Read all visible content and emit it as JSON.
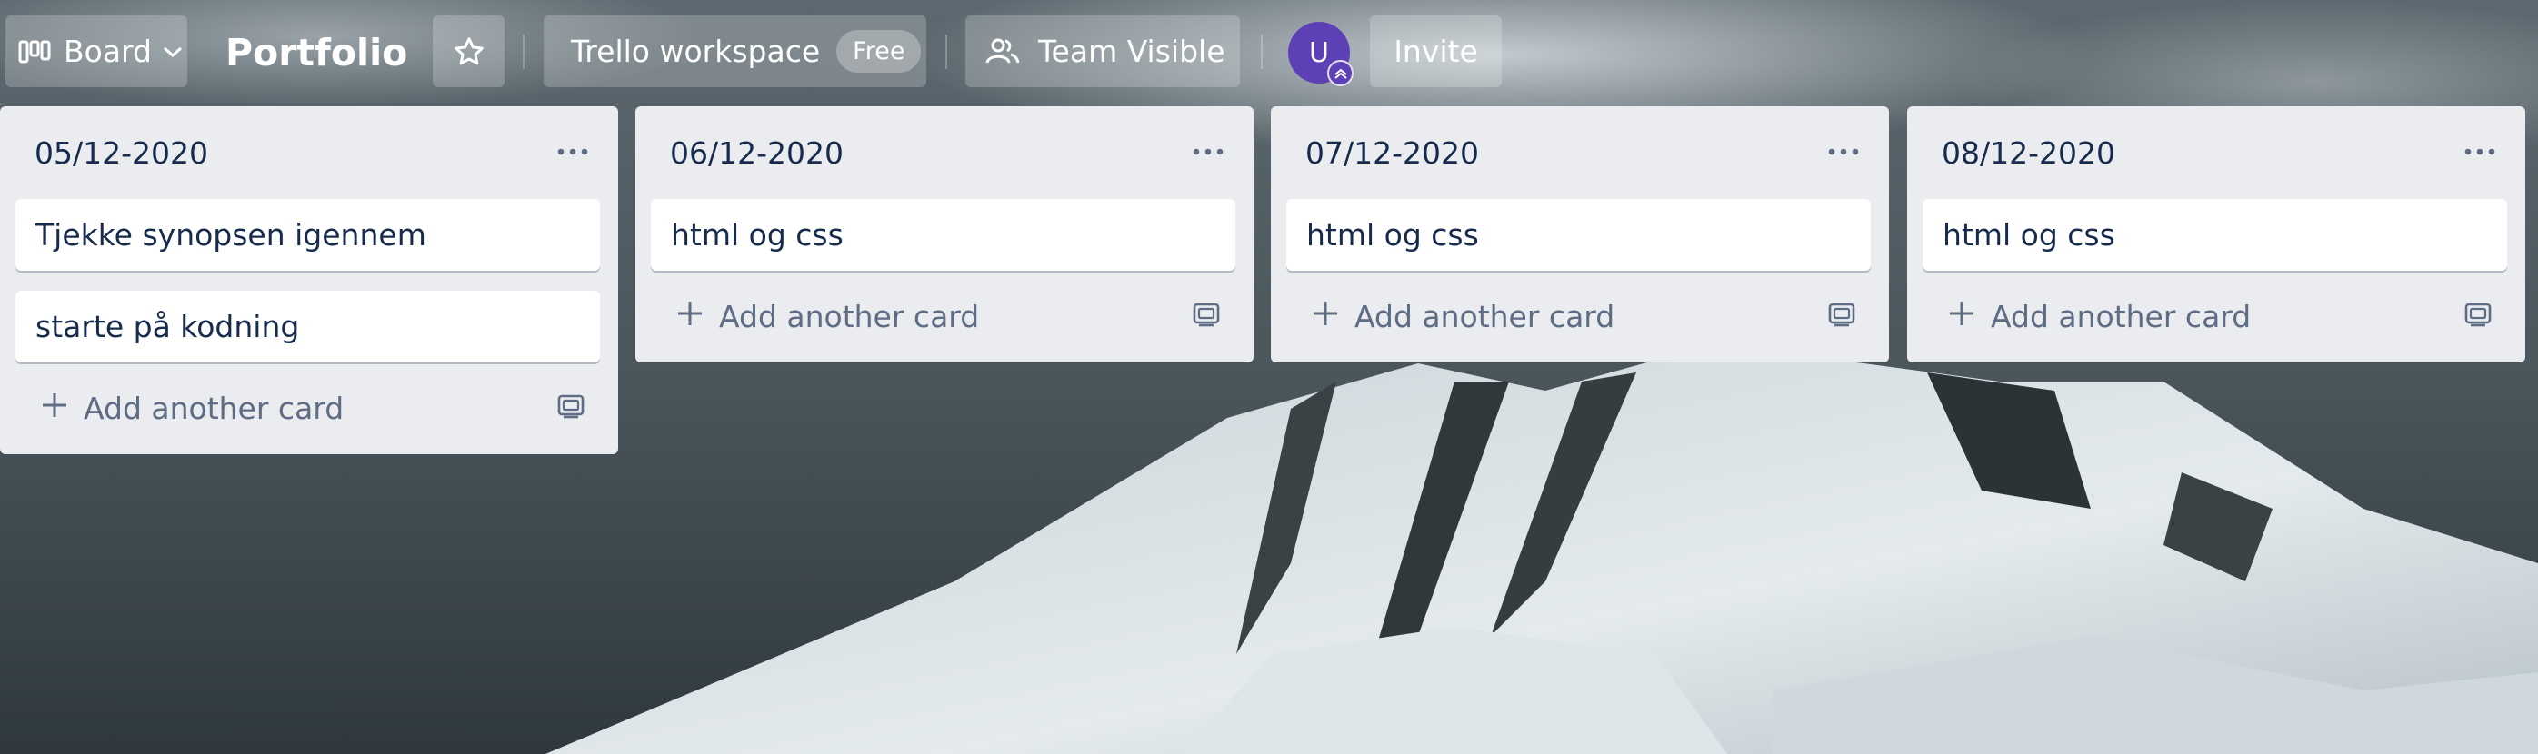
{
  "header": {
    "board_view_label": "Board",
    "board_title": "Portfolio",
    "workspace_label": "Trello workspace",
    "workspace_badge": "Free",
    "visibility_label": "Team Visible",
    "avatar_initial": "U",
    "invite_label": "Invite"
  },
  "lists": [
    {
      "title": "05/12-2020",
      "cards": [
        "Tjekke synopsen igennem",
        "starte på kodning"
      ],
      "add_card_label": "Add another card"
    },
    {
      "title": "06/12-2020",
      "cards": [
        "html og css"
      ],
      "add_card_label": "Add another card"
    },
    {
      "title": "07/12-2020",
      "cards": [
        "html og css"
      ],
      "add_card_label": "Add another card"
    },
    {
      "title": "08/12-2020",
      "cards": [
        "html og css"
      ],
      "add_card_label": "Add another card"
    }
  ],
  "colors": {
    "list_bg": "#ebecf0",
    "card_text": "#172b4d",
    "muted_text": "#5e6c84",
    "avatar": "#5e40b6"
  },
  "background_image": "snowy mountain peak under cloudy sky"
}
